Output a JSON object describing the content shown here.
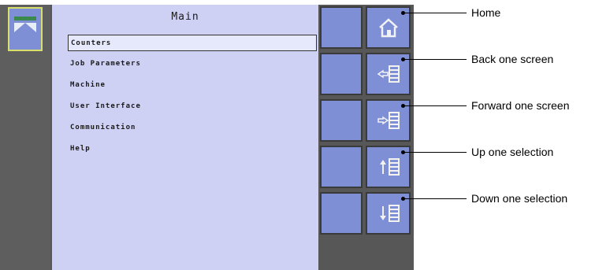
{
  "screen": {
    "title": "Main",
    "menu": [
      {
        "label": "Counters",
        "selected": true
      },
      {
        "label": "Job Parameters",
        "selected": false
      },
      {
        "label": "Machine",
        "selected": false
      },
      {
        "label": "User Interface",
        "selected": false
      },
      {
        "label": "Communication",
        "selected": false
      },
      {
        "label": "Help",
        "selected": false
      }
    ],
    "app_icon": "spreader-icon"
  },
  "nav_buttons": [
    {
      "icon": "home-icon",
      "callout": "Home"
    },
    {
      "icon": "back-screen-icon",
      "callout": "Back one screen"
    },
    {
      "icon": "forward-screen-icon",
      "callout": "Forward one screen"
    },
    {
      "icon": "up-selection-icon",
      "callout": "Up one selection"
    },
    {
      "icon": "down-selection-icon",
      "callout": "Down one selection"
    }
  ],
  "colors": {
    "panel_bg": "#cfd1f4",
    "button_bg": "#7e8fd6",
    "device_bg": "#575757",
    "highlight_border": "#d8df6a"
  }
}
